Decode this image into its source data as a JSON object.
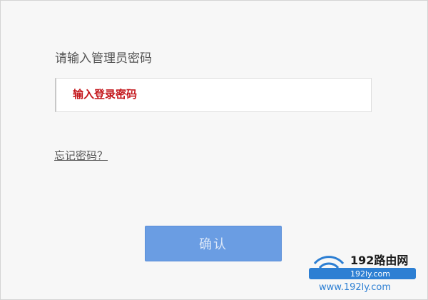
{
  "login": {
    "prompt_label": "请输入管理员密码",
    "password_placeholder": "输入登录密码",
    "forgot_link": "忘记密码？",
    "confirm_button": "确认"
  },
  "watermark": {
    "brand": "192路由网",
    "domain": "192ly.com",
    "url": "www.192ly.com"
  },
  "colors": {
    "button": "#6a9de3",
    "placeholder_text": "#c4171c",
    "watermark_accent": "#2d7fd3"
  }
}
